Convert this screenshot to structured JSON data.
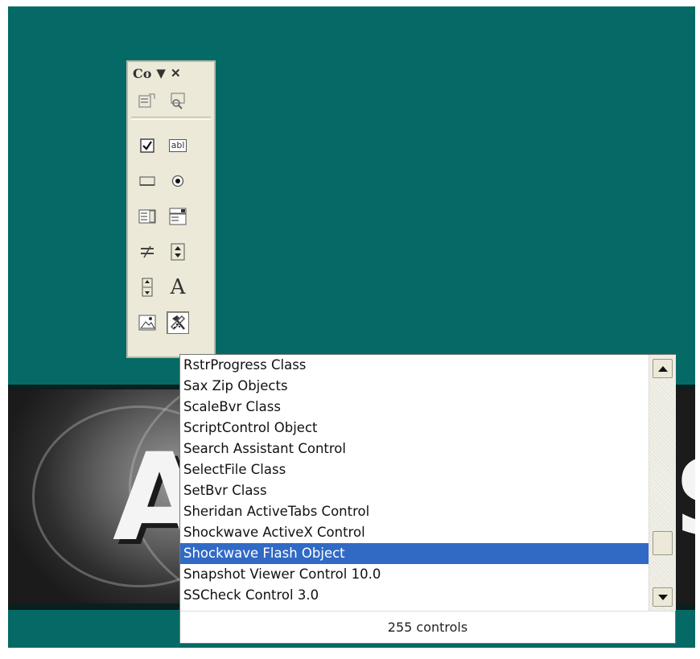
{
  "toolbox": {
    "title": "Co",
    "dropdown_icon": "chevron-down-icon",
    "close_icon": "close-icon",
    "tools": [
      "properties-icon",
      "view-code-icon",
      "checkbox-icon",
      "textbox-icon",
      "command-button-icon",
      "option-button-icon",
      "listbox-icon",
      "combobox-icon",
      "toggle-button-icon",
      "spin-button-icon",
      "scrollbar-icon",
      "label-icon",
      "image-icon",
      "more-controls-icon"
    ],
    "textbox_glyph": "abl",
    "label_glyph": "A"
  },
  "controls_list": {
    "items": [
      "RstrProgress Class",
      "Sax Zip Objects",
      "ScaleBvr Class",
      "ScriptControl Object",
      "Search Assistant Control",
      "SelectFile Class",
      "SetBvr Class",
      "Sheridan ActiveTabs Control",
      "Shockwave ActiveX Control",
      "Shockwave Flash Object",
      "Snapshot Viewer Control 10.0",
      "SSCheck Control 3.0"
    ],
    "selected": "Shockwave Flash Object",
    "status": "255 controls"
  },
  "colors": {
    "desktop": "#056a66",
    "selection": "#316ac5",
    "toolbox_bg": "#ece9d8"
  }
}
